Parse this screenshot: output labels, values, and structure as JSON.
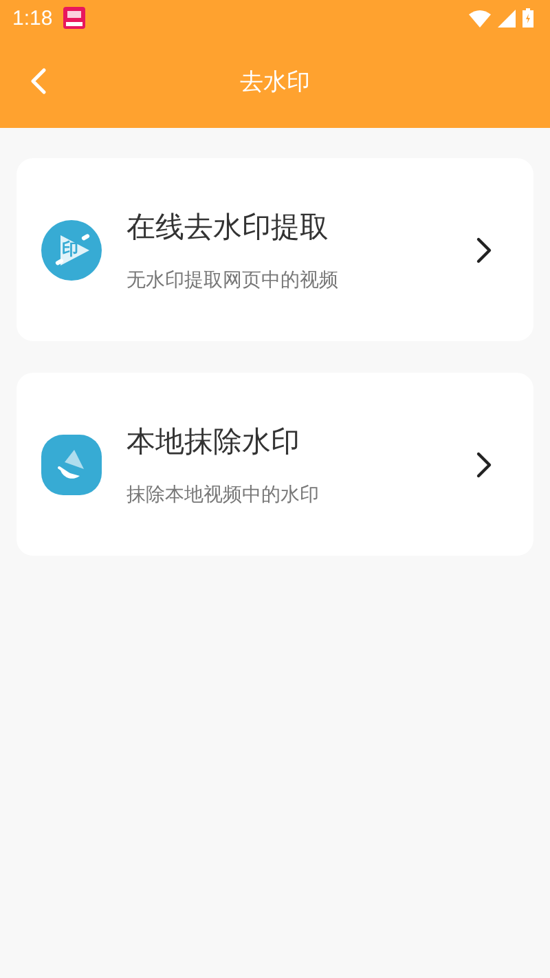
{
  "status_bar": {
    "time": "1:18"
  },
  "header": {
    "title": "去水印"
  },
  "cards": [
    {
      "kind": "online",
      "icon_text": "印",
      "title": "在线去水印提取",
      "subtitle": "无水印提取网页中的视频"
    },
    {
      "kind": "local",
      "title": "本地抹除水印",
      "subtitle": "抹除本地视频中的水印"
    }
  ]
}
